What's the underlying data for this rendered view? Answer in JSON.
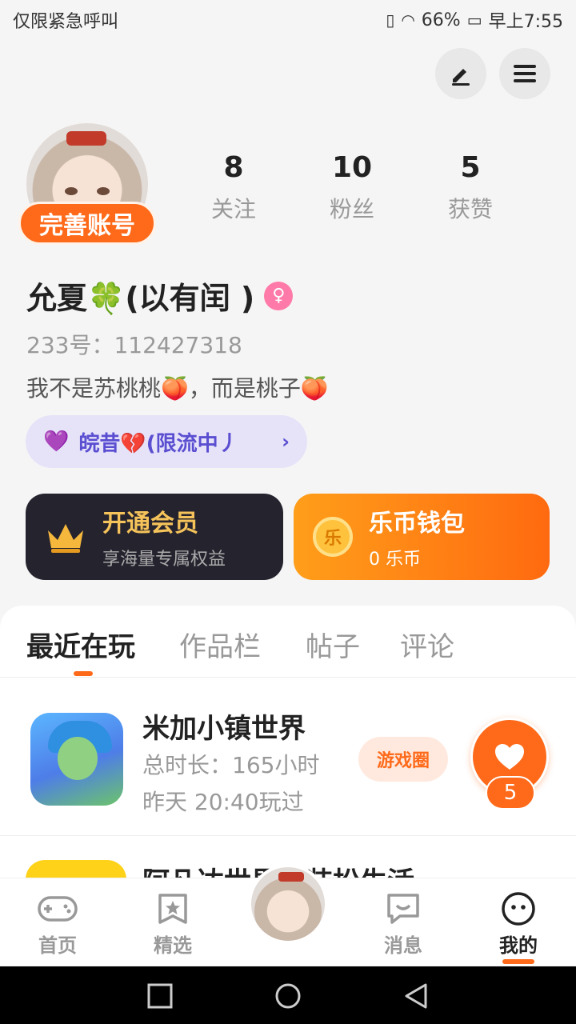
{
  "status_bar": {
    "left_text": "仅限紧急呼叫",
    "battery": "66%",
    "time": "早上7:55"
  },
  "profile": {
    "complete_badge": "完善账号",
    "stats": [
      {
        "value": "8",
        "label": "关注"
      },
      {
        "value": "10",
        "label": "粉丝"
      },
      {
        "value": "5",
        "label": "获赞"
      }
    ],
    "name": "允夏🍀(以有闰 )",
    "gender_icon": "female-icon",
    "uid": "233号：112427318",
    "bio": "我不是苏桃桃🍑，而是桃子🍑",
    "tag": "皖昔💔(限流中丿"
  },
  "cards": {
    "vip": {
      "title": "开通会员",
      "subtitle": "享海量专属权益"
    },
    "wallet": {
      "title": "乐币钱包",
      "subtitle": "0 乐币",
      "coin_label": "乐"
    }
  },
  "tabs": [
    "最近在玩",
    "作品栏",
    "帖子",
    "评论"
  ],
  "active_tab": "最近在玩",
  "games": [
    {
      "name": "米加小镇世界",
      "duration": "总时长：165小时",
      "last_played": "昨天 20:40玩过",
      "button": "游戏圈"
    },
    {
      "name": "阿凡达世界：装扮生活"
    }
  ],
  "like": {
    "count": "5"
  },
  "bottom_nav": [
    {
      "label": "首页",
      "icon": "gamepad-icon"
    },
    {
      "label": "精选",
      "icon": "star-bookmark-icon"
    },
    {
      "label": "消息",
      "icon": "message-icon"
    },
    {
      "label": "我的",
      "icon": "face-icon",
      "active": true
    }
  ],
  "colors": {
    "accent": "#ff6a1a",
    "vip_gold": "#f5c35a",
    "tag_purple": "#5a4ed1"
  }
}
